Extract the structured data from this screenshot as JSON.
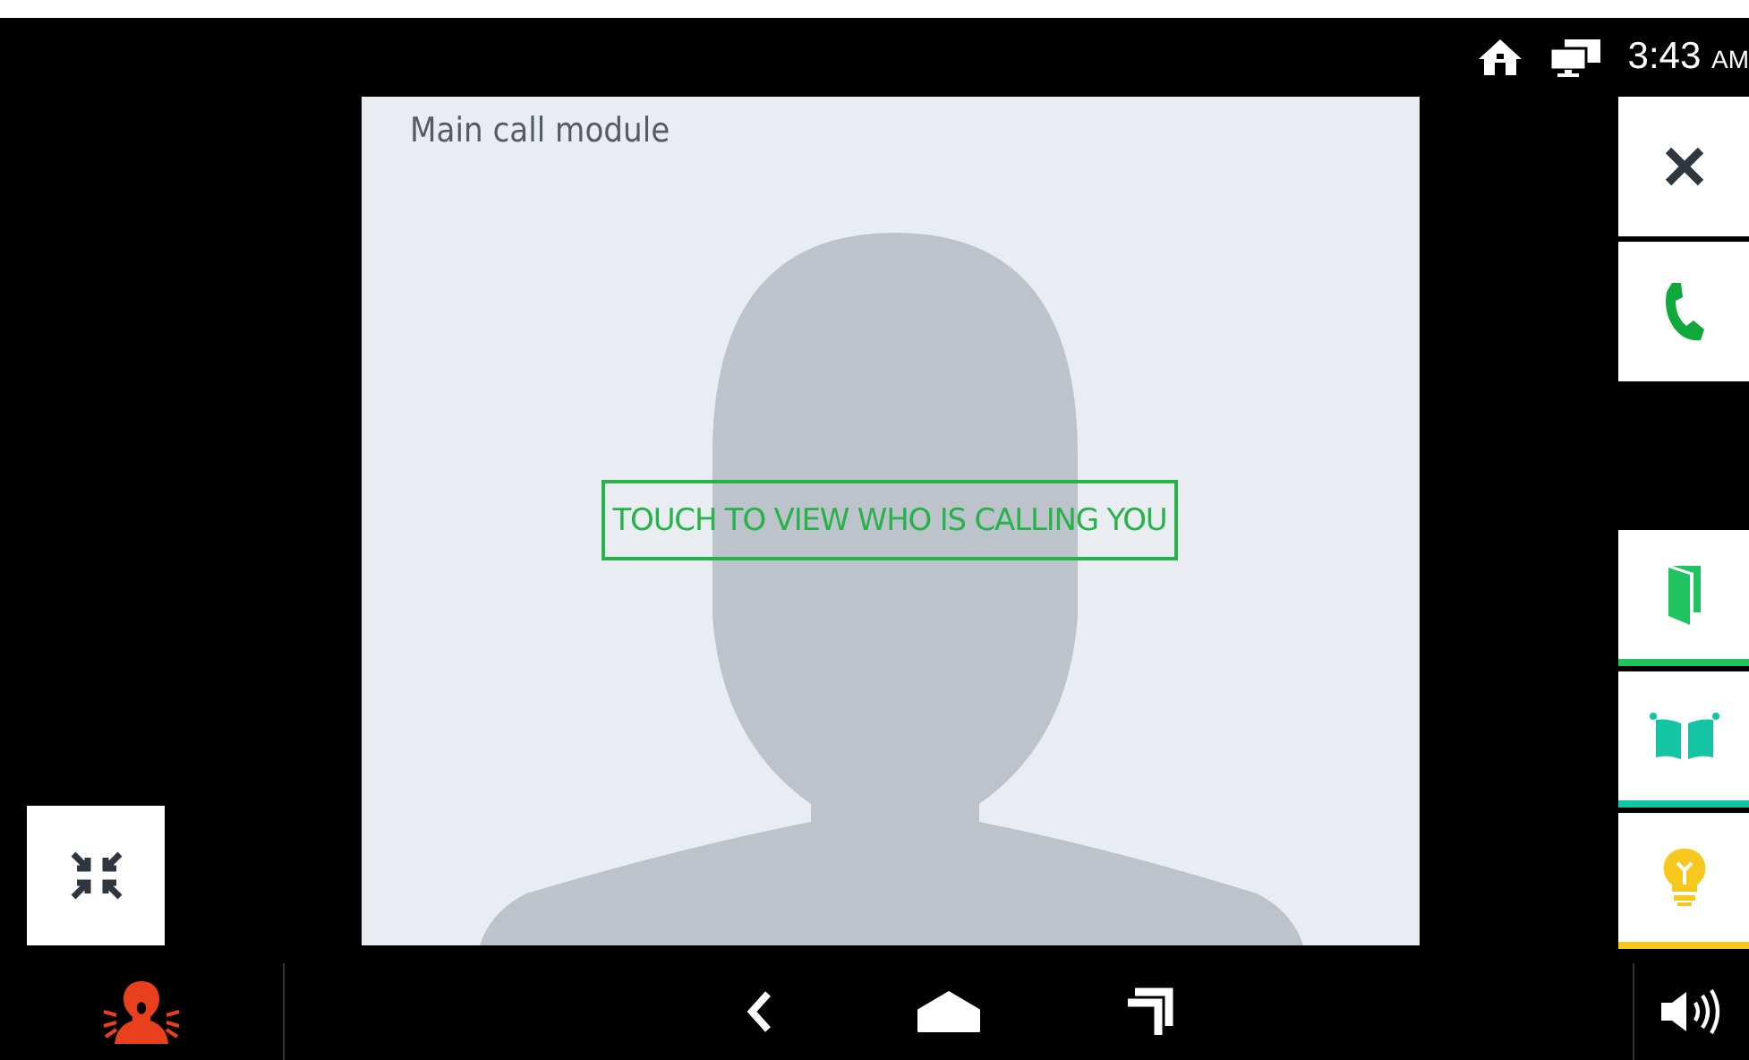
{
  "status_bar": {
    "time": "3:43",
    "period": "AM"
  },
  "video": {
    "caption": "Main call module",
    "prompt": "TOUCH TO VIEW WHO IS CALLING YOU"
  },
  "call_buttons": [
    {
      "kind": "reject"
    },
    {
      "kind": "answer"
    }
  ],
  "actions": [
    {
      "kind": "door",
      "color": "#1fc35f"
    },
    {
      "kind": "gate",
      "color": "#14c5a4"
    },
    {
      "kind": "light",
      "color": "#f6c81e"
    }
  ],
  "minimize": {
    "kind": "minimize"
  },
  "nav_bar": {
    "alarm": {
      "kind": "alarm"
    },
    "volume": {
      "kind": "volume"
    }
  }
}
